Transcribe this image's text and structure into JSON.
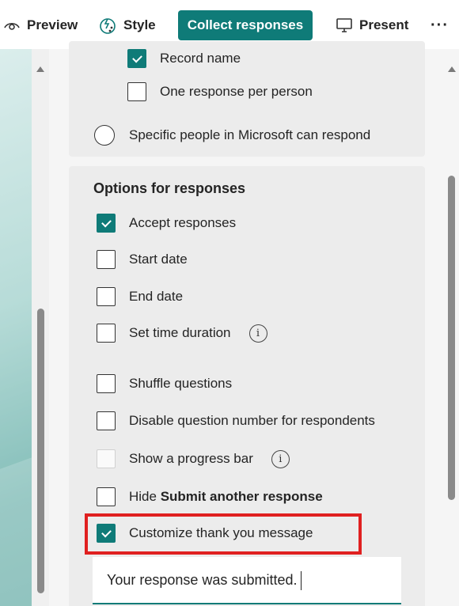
{
  "toolbar": {
    "preview_label": "Preview",
    "style_label": "Style",
    "collect_label": "Collect responses",
    "present_label": "Present",
    "more_label": "···"
  },
  "top_options": {
    "record_name": {
      "label": "Record name",
      "checked": true
    },
    "one_response": {
      "label": "One response per person",
      "checked": false
    },
    "specific_people": {
      "label": "Specific people in Microsoft can respond",
      "selected": false
    }
  },
  "options_for_responses": {
    "title": "Options for responses",
    "items": [
      {
        "label": "Accept responses",
        "checked": true
      },
      {
        "label": "Start date",
        "checked": false
      },
      {
        "label": "End date",
        "checked": false
      },
      {
        "label": "Set time duration",
        "checked": false,
        "info_icon": "info-icon"
      },
      {
        "label": "Shuffle questions",
        "checked": false
      },
      {
        "label": "Disable question number for respondents",
        "checked": false
      },
      {
        "label": "Show a progress bar",
        "checked": false,
        "disabled": true,
        "info_icon": "info-icon"
      },
      {
        "label_prefix": "Hide ",
        "label_bold": "Submit another response",
        "checked": false
      },
      {
        "label": "Customize thank you message",
        "checked": true
      }
    ],
    "thank_you_message": "Your response was submitted."
  },
  "colors": {
    "accent": "#0f7b78",
    "highlight": "#e02020"
  }
}
